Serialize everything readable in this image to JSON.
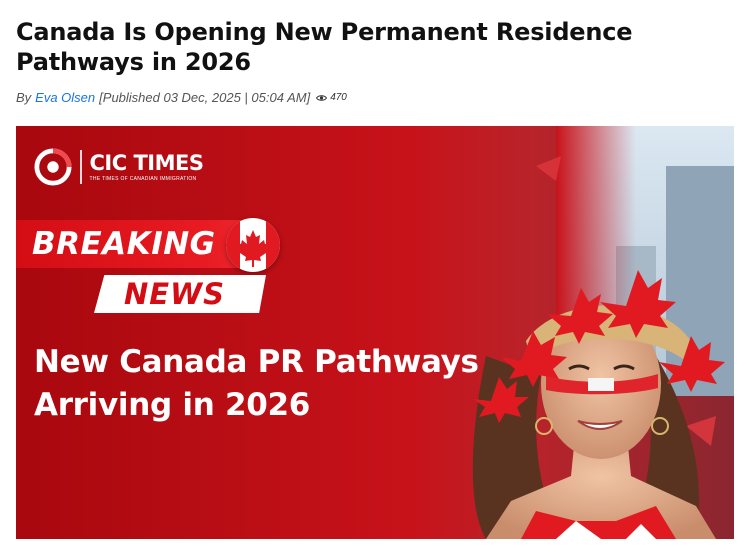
{
  "article": {
    "headline": "Canada Is Opening New Permanent Residence Pathways in 2026",
    "byline_prefix": "By",
    "author": "Eva Olsen",
    "published": "[Published 03 Dec, 2025 | 05:04 AM]",
    "views": "470"
  },
  "banner": {
    "logo_name": "CIC TIMES",
    "logo_tagline": "THE TIMES OF CANADIAN IMMIGRATION",
    "breaking": "BREAKING",
    "news": "NEWS",
    "title": "New Canada PR Pathways Arriving in 2026"
  },
  "colors": {
    "brand_red": "#d40d14",
    "link_blue": "#1a73e8",
    "text_dark": "#111111"
  },
  "icons": {
    "views": "eye-icon",
    "logo": "cic-logo-icon",
    "flag": "maple-leaf-flag-icon"
  }
}
